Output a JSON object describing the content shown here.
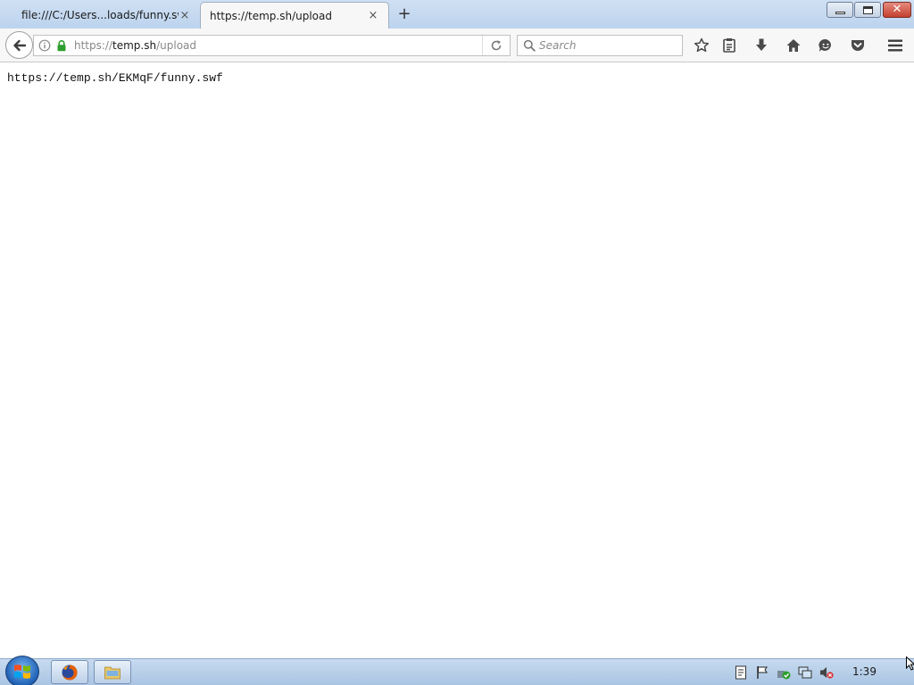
{
  "tabs": [
    {
      "title": "file:///C:/Users...loads/funny.swf",
      "close": "×",
      "active": false
    },
    {
      "title": "https://temp.sh/upload",
      "close": "×",
      "active": true
    }
  ],
  "new_tab_label": "+",
  "window_controls": {
    "close": "✕"
  },
  "navbar": {
    "url": {
      "scheme": "https://",
      "host": "temp.sh",
      "path": "/upload"
    },
    "search_placeholder": "Search",
    "icons": [
      "back-icon",
      "info-icon",
      "lock-icon",
      "reload-icon",
      "search-icon",
      "bookmark-star-icon",
      "reading-list-icon",
      "download-icon",
      "home-icon",
      "emoji-icon",
      "pocket-icon",
      "menu-icon"
    ]
  },
  "content": {
    "result_text": "https://temp.sh/EKMqF/funny.swf"
  },
  "taskbar": {
    "clock": "1:39",
    "apps": [
      "firefox-icon",
      "explorer-icon"
    ],
    "tray_icons": [
      "notes-icon",
      "flag-icon",
      "security-icon",
      "network-icon",
      "volume-muted-icon"
    ]
  },
  "colors": {
    "tabstrip": "#bcd3ee",
    "lock_green": "#2e9e2e",
    "taskbar": "#a9c4e3",
    "close_red": "#c4402f"
  }
}
